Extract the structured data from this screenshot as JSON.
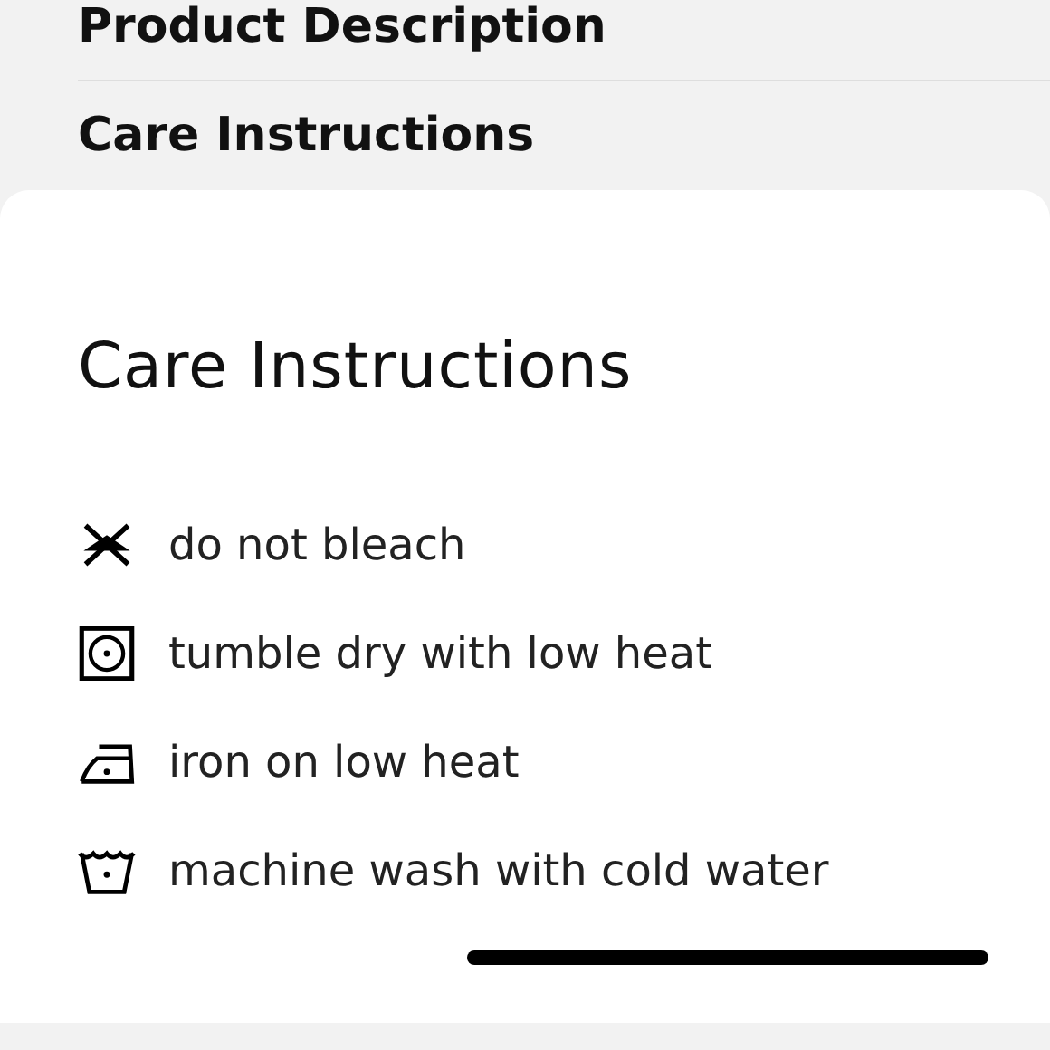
{
  "background_sections": [
    {
      "title": "Product Description"
    },
    {
      "title": "Care Instructions"
    }
  ],
  "sheet": {
    "title": "Care Instructions",
    "items": [
      {
        "kind": "no-bleach",
        "label": "do not bleach"
      },
      {
        "kind": "tumble-dry",
        "label": "tumble dry with low heat"
      },
      {
        "kind": "iron",
        "label": "iron on low heat"
      },
      {
        "kind": "wash",
        "label": "machine wash with cold water"
      }
    ]
  }
}
